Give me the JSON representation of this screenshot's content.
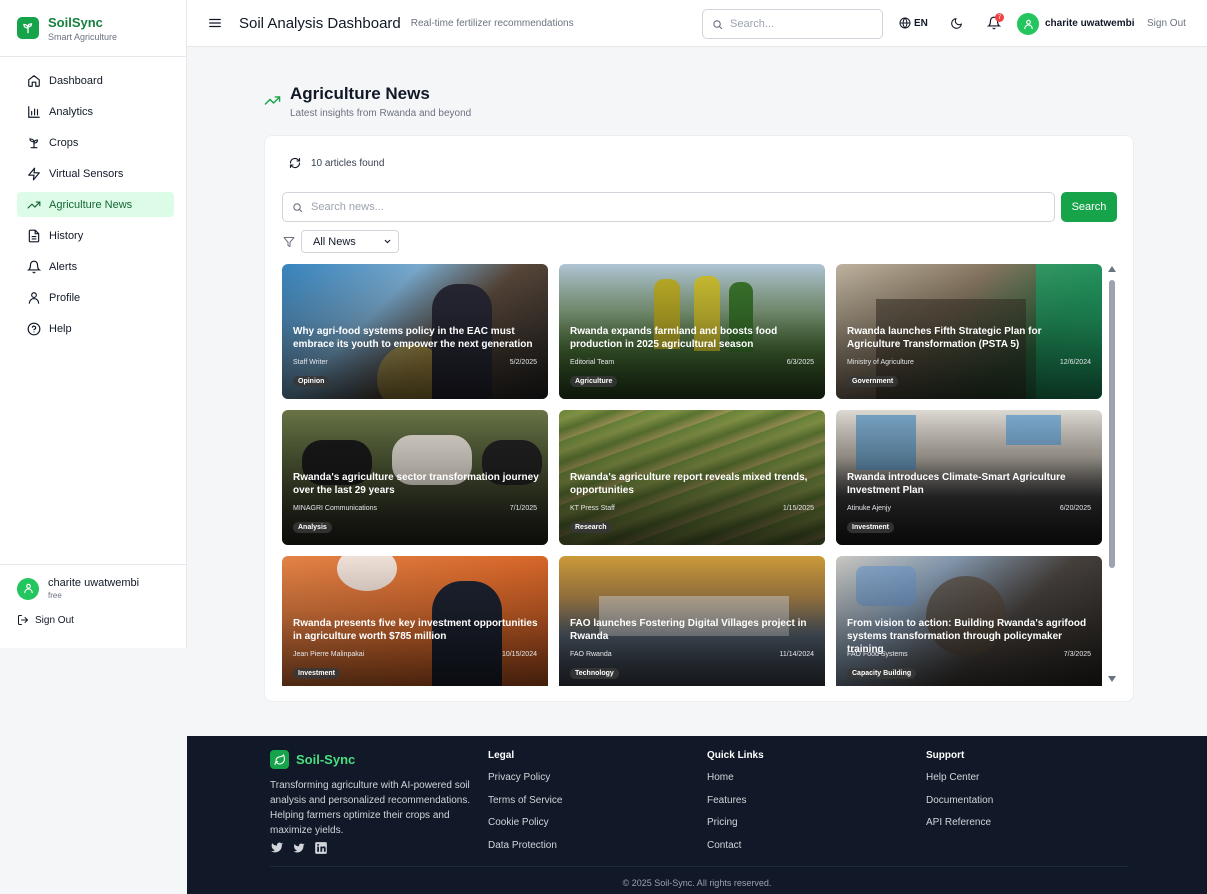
{
  "brand": {
    "name": "SoilSync",
    "tagline": "Smart Agriculture"
  },
  "sidebar": {
    "items": [
      {
        "label": "Dashboard",
        "icon": "home-icon"
      },
      {
        "label": "Analytics",
        "icon": "bar-chart-icon"
      },
      {
        "label": "Crops",
        "icon": "sprout-icon"
      },
      {
        "label": "Virtual Sensors",
        "icon": "zap-icon"
      },
      {
        "label": "Agriculture News",
        "icon": "trending-up-icon",
        "active": true
      },
      {
        "label": "History",
        "icon": "file-text-icon"
      },
      {
        "label": "Alerts",
        "icon": "bell-icon"
      },
      {
        "label": "Profile",
        "icon": "user-icon"
      },
      {
        "label": "Help",
        "icon": "help-circle-icon"
      }
    ],
    "user": {
      "name": "charite uwatwembi",
      "plan": "free"
    },
    "signout": "Sign Out"
  },
  "header": {
    "title": "Soil Analysis Dashboard",
    "subtitle": "Real-time fertilizer recommendations",
    "search_placeholder": "Search...",
    "language": "EN",
    "notification_count": "7",
    "user_name": "charite uwatwembi",
    "signout": "Sign Out"
  },
  "main": {
    "title": "Agriculture News",
    "subtitle": "Latest insights from Rwanda and beyond",
    "count_text": "10 articles found",
    "search_placeholder": "Search news...",
    "search_button": "Search",
    "filter_value": "All News",
    "articles": [
      {
        "title": "Why agri-food systems policy in the EAC must embrace its youth to empower the next generation",
        "author": "Staff Writer",
        "date": "5/2/2025",
        "tag": "Opinion"
      },
      {
        "title": "Rwanda expands farmland and boosts food production in 2025 agricultural season",
        "author": "Editorial Team",
        "date": "6/3/2025",
        "tag": "Agriculture"
      },
      {
        "title": "Rwanda launches Fifth Strategic Plan for Agriculture Transformation (PSTA 5)",
        "author": "Ministry of Agriculture",
        "date": "12/6/2024",
        "tag": "Government"
      },
      {
        "title": "Rwanda's agriculture sector transformation journey over the last 29 years",
        "author": "MINAGRI Communications",
        "date": "7/1/2025",
        "tag": "Analysis"
      },
      {
        "title": "Rwanda's agriculture report reveals mixed trends, opportunities",
        "author": "KT Press Staff",
        "date": "1/15/2025",
        "tag": "Research"
      },
      {
        "title": "Rwanda introduces Climate-Smart Agriculture Investment Plan",
        "author": "Atinuke Ajenjy",
        "date": "6/20/2025",
        "tag": "Investment"
      },
      {
        "title": "Rwanda presents five key investment opportunities in agriculture worth $785 million",
        "author": "Jean Pierre Malinpakai",
        "date": "10/15/2024",
        "tag": "Investment"
      },
      {
        "title": "FAO launches Fostering Digital Villages project in Rwanda",
        "author": "FAO Rwanda",
        "date": "11/14/2024",
        "tag": "Technology"
      },
      {
        "title": "From vision to action: Building Rwanda's agrifood systems transformation through policymaker training",
        "author": "FAO Food Systems",
        "date": "7/3/2025",
        "tag": "Capacity Building"
      }
    ]
  },
  "footer": {
    "brand": "Soil-Sync",
    "description": "Transforming agriculture with AI-powered soil analysis and personalized recommendations. Helping farmers optimize their crops and maximize yields.",
    "columns": [
      {
        "title": "Legal",
        "links": [
          "Privacy Policy",
          "Terms of Service",
          "Cookie Policy",
          "Data Protection"
        ]
      },
      {
        "title": "Quick Links",
        "links": [
          "Home",
          "Features",
          "Pricing",
          "Contact"
        ]
      },
      {
        "title": "Support",
        "links": [
          "Help Center",
          "Documentation",
          "API Reference"
        ]
      }
    ],
    "copyright": "© 2025 Soil-Sync. All rights reserved."
  },
  "colors": {
    "accent": "#16a34a",
    "active_bg": "#dcfce7",
    "footer_bg": "#111827"
  }
}
